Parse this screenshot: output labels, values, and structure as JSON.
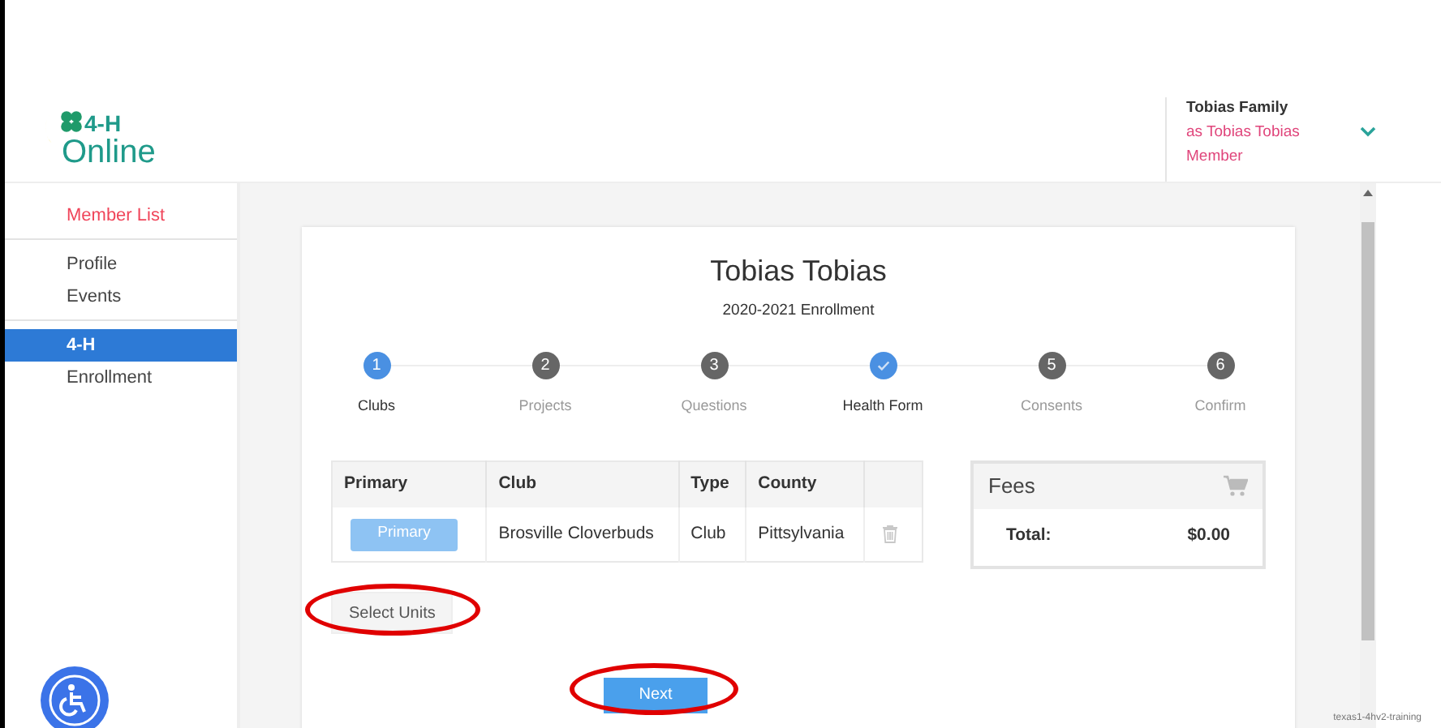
{
  "header": {
    "logo": {
      "line_1": "4-H",
      "line_2": "Online"
    },
    "user": {
      "name": "Tobias Family",
      "acting_as": "as Tobias Tobias",
      "role": "Member"
    }
  },
  "sidebar": {
    "sections": [
      [
        {
          "label": "Member List",
          "kind": "link",
          "selected": false
        }
      ],
      [
        {
          "label": "Profile",
          "kind": "nav",
          "selected": false
        },
        {
          "label": "Events",
          "kind": "nav",
          "selected": false
        }
      ],
      [
        {
          "label": "4-H",
          "kind": "nav",
          "selected": true
        },
        {
          "label": "Enrollment",
          "kind": "nav",
          "selected": false
        }
      ]
    ]
  },
  "card": {
    "title": "Tobias Tobias",
    "subtitle": "2020-2021 Enrollment",
    "steps": [
      {
        "marker": "1",
        "label": "Clubs",
        "kind": "active"
      },
      {
        "marker": "2",
        "label": "Projects",
        "kind": "pending"
      },
      {
        "marker": "3",
        "label": "Questions",
        "kind": "pending"
      },
      {
        "label": "Health Form",
        "kind": "complete"
      },
      {
        "marker": "5",
        "label": "Consents",
        "kind": "pending"
      },
      {
        "marker": "6",
        "label": "Confirm",
        "kind": "pending"
      }
    ],
    "table": {
      "columns": [
        "Primary",
        "Club",
        "Type",
        "County"
      ],
      "rows": [
        {
          "primary_button": "Primary",
          "club": "Brosville Cloverbuds",
          "type": "Club",
          "county": "Pittsylvania"
        }
      ]
    },
    "fees": {
      "title": "Fees",
      "total_label": "Total:",
      "total": "$0.00"
    },
    "select_units": {
      "label": "Select Units",
      "highlighted": true
    },
    "next": {
      "label": "Next",
      "highlighted": true
    }
  },
  "footer": {
    "server": "texas1-4hv2-training"
  }
}
